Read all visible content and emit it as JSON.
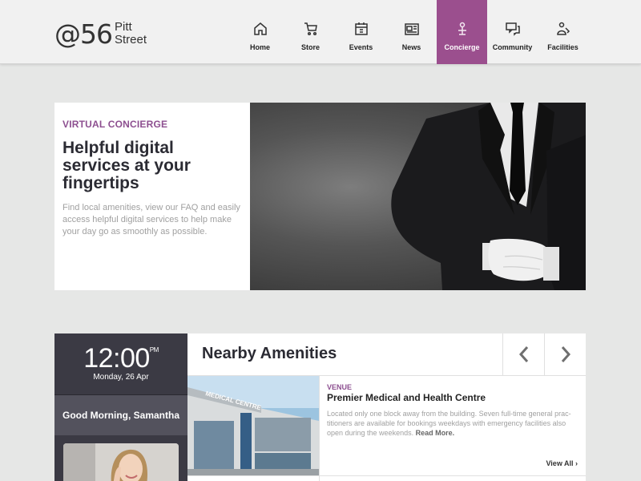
{
  "logo": {
    "main": "@56",
    "line1": "Pitt",
    "line2": "Street"
  },
  "nav": [
    {
      "label": "Home",
      "icon": "home-icon"
    },
    {
      "label": "Store",
      "icon": "cart-icon"
    },
    {
      "label": "Events",
      "icon": "calendar-icon"
    },
    {
      "label": "News",
      "icon": "newspaper-icon"
    },
    {
      "label": "Concierge",
      "icon": "concierge-icon",
      "active": true
    },
    {
      "label": "Community",
      "icon": "chat-icon"
    },
    {
      "label": "Facilities",
      "icon": "facilities-icon"
    }
  ],
  "hero": {
    "eyebrow": "VIRTUAL CONCIERGE",
    "title": "Helpful digital services at your fingertips",
    "description": "Find local amenities, view our FAQ and easily access helpful digital services to help make your day go as smoothly as possible."
  },
  "clock": {
    "time": "12:00",
    "ampm": "PM",
    "date": "Monday, 26 Apr",
    "greeting": "Good Morning, Samantha"
  },
  "amenities": {
    "title": "Nearby Amenities",
    "sign_text": "MEDICAL CENTRE",
    "venue_label": "VENUE",
    "venue_title": "Premier Medical and Health Centre",
    "venue_desc": "Located only one block away from the building. Seven full-time general prac-titioners are available for bookings weekdays with emergency facilities also open during the weekends.",
    "read_more": "Read More.",
    "view_all": "View All"
  },
  "colors": {
    "accent": "#9b4f8e",
    "eyebrow": "#8d4f90",
    "clock_bg": "#3b3a44",
    "greeting_bg": "#53525d"
  }
}
